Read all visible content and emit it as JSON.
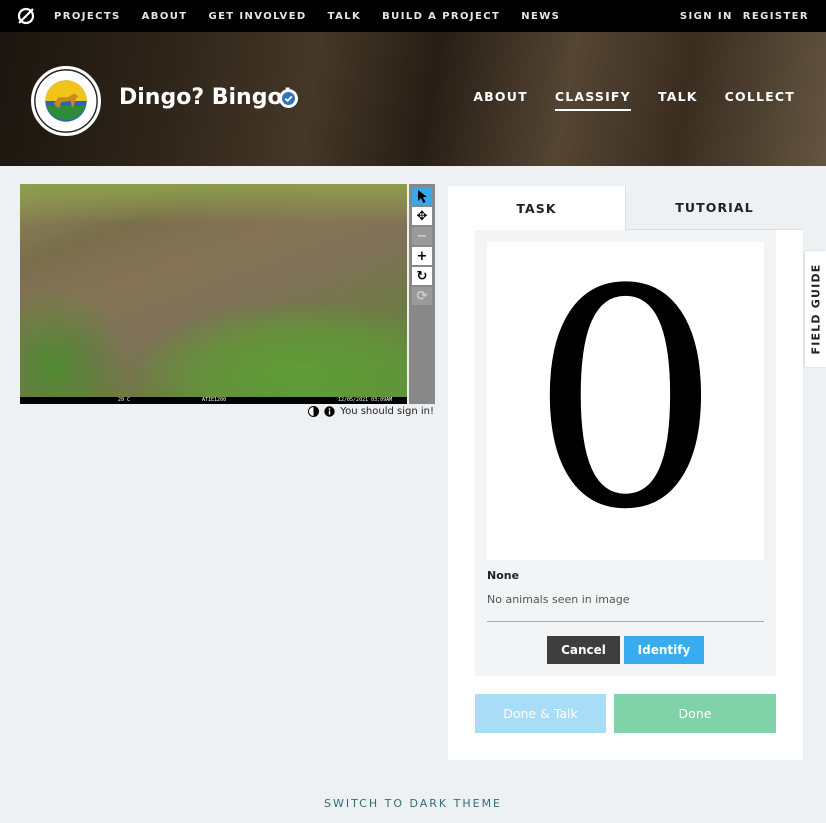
{
  "topnav": {
    "links": [
      "PROJECTS",
      "ABOUT",
      "GET INVOLVED",
      "TALK",
      "BUILD A PROJECT",
      "NEWS"
    ],
    "sign_in": "SIGN IN",
    "register": "REGISTER"
  },
  "project": {
    "title": "Dingo? Bingo!",
    "avatar_text": "Myall Lakes Dingo Project",
    "nav": [
      "ABOUT",
      "CLASSIFY",
      "TALK",
      "COLLECT"
    ],
    "active_nav": "CLASSIFY"
  },
  "viewer": {
    "info_temp": "20 C",
    "info_camera": "ATIE1200",
    "info_datetime": "12/05/2021 03:09AM",
    "sign_in_notice": "You should sign in!"
  },
  "task_panel": {
    "tabs": [
      "TASK",
      "TUTORIAL"
    ],
    "choice_image_text": "0",
    "choice_name": "None",
    "choice_description": "No animals seen in image",
    "cancel_label": "Cancel",
    "identify_label": "Identify",
    "done_talk_label": "Done & Talk",
    "done_label": "Done"
  },
  "field_guide_label": "FIELD GUIDE",
  "theme_toggle_label": "SWITCH TO DARK THEME",
  "colors": {
    "topnav_bg": "#000000",
    "page_bg": "#eef1f4",
    "identify_blue": "#37adf0",
    "done_green": "#80d3a8",
    "done_talk_blue": "#a9dcf7",
    "cancel_dark": "#3e3e3e",
    "theme_link": "#2f6f6f"
  }
}
